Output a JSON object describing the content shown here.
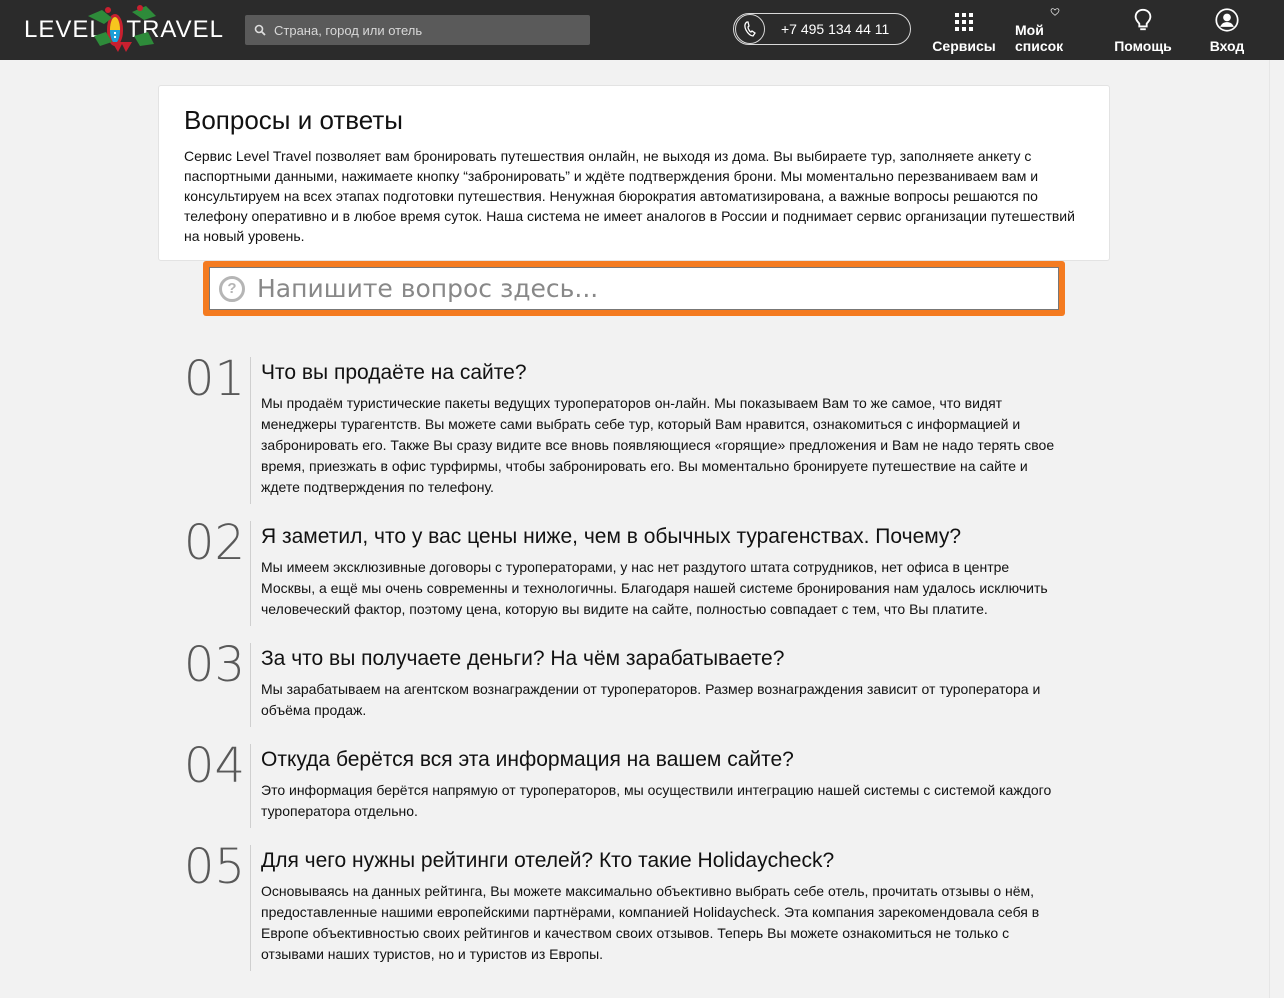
{
  "header": {
    "logo_left": "LEVEL",
    "logo_right": "TRAVEL",
    "search_placeholder": "Страна, город или отель",
    "phone": "+7 495 134 44 11",
    "nav": [
      {
        "label": "Сервисы",
        "icon": "grid-icon"
      },
      {
        "label": "Мой список",
        "icon": "heart-icon"
      },
      {
        "label": "Помощь",
        "icon": "lightbulb-icon"
      },
      {
        "label": "Вход",
        "icon": "user-icon"
      }
    ]
  },
  "intro": {
    "title": "Вопросы и ответы",
    "text": "Сервис Level Travel позволяет вам бронировать путешествия онлайн, не выходя из дома. Вы выбираете тур, заполняете анкету с паспортными данными, нажимаете кнопку “забронировать” и ждёте подтверждения брони. Мы моментально перезваниваем вам и консультируем на всех этапах подготовки путешествия. Ненужная бюрократия автоматизирована, а важные вопросы решаются по телефону оперативно и в любое время суток. Наша система не имеет аналогов в России и поднимает сервис организации путешествий на новый уровень."
  },
  "ask": {
    "placeholder": "Напишите вопрос здесь..."
  },
  "faq": [
    {
      "num": "01",
      "question": "Что вы продаёте на сайте?",
      "answer": "Мы продаём туристические пакеты ведущих туроператоров он-лайн. Мы показываем Вам то же самое, что видят менеджеры турагентств. Вы можете сами выбрать себе тур, который Вам нравится, ознакомиться с информацией и забронировать его. Также Вы сразу видите все вновь появляющиеся «горящие» предложения и Вам не надо терять свое время, приезжать в офис турфирмы, чтобы забронировать его. Вы моментально бронируете путешествие на сайте и ждете подтверждения по телефону."
    },
    {
      "num": "02",
      "question": "Я заметил, что у вас цены ниже, чем в обычных турагенствах. Почему?",
      "answer": "Мы имеем эксклюзивные договоры с туроператорами, у нас нет раздутого штата сотрудников, нет офиса в центре Москвы, а ещё мы очень современны и технологичны. Благодаря нашей системе бронирования нам удалось исключить человеческий фактор, поэтому цена, которую вы видите на сайте, полностью совпадает с тем, что Вы платите."
    },
    {
      "num": "03",
      "question": "За что вы получаете деньги? На чём зарабатываете?",
      "answer": "Мы зарабатываем на агентском вознаграждении от туроператоров. Размер вознаграждения зависит от туроператора и объёма продаж."
    },
    {
      "num": "04",
      "question": "Откуда берётся вся эта информация на вашем сайте?",
      "answer": "Это информация берётся напрямую от туроператоров, мы осуществили интеграцию нашей системы с системой каждого туроператора отдельно."
    },
    {
      "num": "05",
      "question": "Для чего нужны рейтинги отелей? Кто такие Holidaycheck?",
      "answer": "Основываясь на данных рейтинга, Вы можете максимально объективно выбрать себе отель, прочитать отзывы о нём, предоставленные нашими европейскими партнёрами, компанией Holidaycheck. Эта компания зарекомендовала себя в Европе объективностью своих рейтингов и качеством своих отзывов. Теперь Вы можете ознакомиться не только с отзывами наших туристов, но и туристов из Европы."
    }
  ],
  "colors": {
    "header_bg": "#2b2b2b",
    "accent_orange": "#f47b20",
    "page_bg": "#f2f2f2"
  }
}
